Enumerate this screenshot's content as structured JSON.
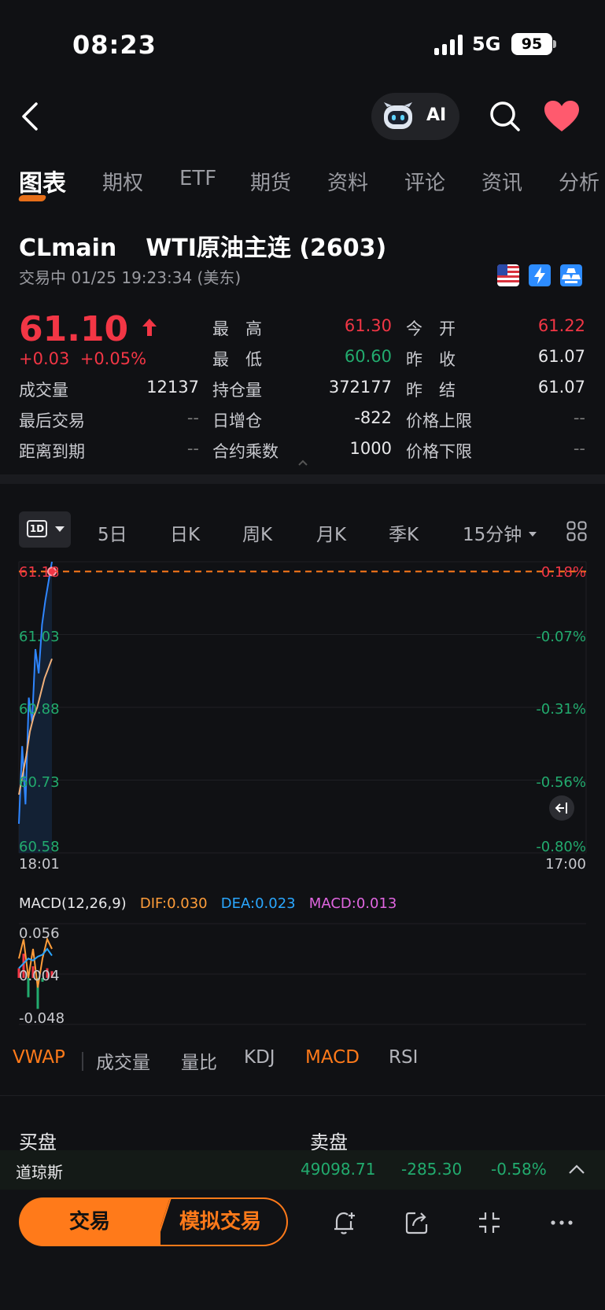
{
  "status_bar": {
    "time": "08:23",
    "network": "5G",
    "battery": "95"
  },
  "nav": {
    "ai_label": "AI"
  },
  "tabs": [
    "图表",
    "期权",
    "ETF",
    "期货",
    "资料",
    "评论",
    "资讯",
    "分析"
  ],
  "quote": {
    "symbol": "CLmain",
    "name": "WTI原油主连 (2603)",
    "status_line": "交易中 01/25 19:23:34 (美东)",
    "last_price": "61.10",
    "change": "+0.03",
    "change_pct": "+0.05%",
    "fields": {
      "high_label": "最　高",
      "high": "61.30",
      "open_label": "今　开",
      "open": "61.22",
      "low_label": "最　低",
      "low": "60.60",
      "prev_close_label": "昨　收",
      "prev_close": "61.07",
      "volume_label": "成交量",
      "volume": "12137",
      "oi_label": "持仓量",
      "oi": "372177",
      "prev_settle_label": "昨　结",
      "prev_settle": "61.07",
      "last_trade_label": "最后交易",
      "last_trade": "--",
      "oi_change_label": "日增仓",
      "oi_change": "-822",
      "limit_up_label": "价格上限",
      "limit_up": "--",
      "to_expiry_label": "距离到期",
      "to_expiry": "--",
      "multiplier_label": "合约乘数",
      "multiplier": "1000",
      "limit_down_label": "价格下限",
      "limit_down": "--"
    }
  },
  "periods": {
    "active": "1D",
    "items": [
      "5日",
      "日K",
      "周K",
      "月K",
      "季K",
      "15分钟"
    ]
  },
  "chart_data": [
    {
      "type": "line",
      "series": [
        {
          "values": [
            60.64,
            60.8,
            60.68,
            60.9,
            60.85,
            61.0,
            60.95,
            61.05,
            61.1,
            61.14,
            61.18
          ]
        },
        {
          "values": [
            60.7,
            60.74,
            60.78,
            60.83,
            60.86,
            60.88,
            60.91,
            60.94,
            60.96,
            60.98
          ]
        }
      ],
      "y_ticks_left": [
        "61.18",
        "61.03",
        "60.88",
        "60.73",
        "60.58"
      ],
      "y_ticks_right": [
        "0.18%",
        "-0.07%",
        "-0.31%",
        "-0.56%",
        "-0.80%"
      ],
      "x_ticks": [
        "18:01",
        "17:00"
      ],
      "ylim": [
        60.58,
        61.18
      ],
      "reference_price": 61.1,
      "grid": true
    },
    {
      "type": "line",
      "title": "MACD(12,26,9)",
      "indicators": {
        "dif": "DIF:0.030",
        "dea": "DEA:0.023",
        "macd": "MACD:0.013"
      },
      "y_ticks": [
        "0.056",
        "0.004",
        "-0.048"
      ],
      "ylim": [
        -0.048,
        0.056
      ],
      "series": [
        {
          "values": [
            0.02,
            0.04,
            0.0,
            0.03,
            -0.01,
            0.02,
            0.04,
            0.03
          ]
        },
        {
          "values": [
            0.01,
            0.015,
            0.02,
            0.018,
            0.022,
            0.024,
            0.03,
            0.023
          ]
        }
      ]
    }
  ],
  "indicator_tabs": [
    "VWAP",
    "成交量",
    "量比",
    "KDJ",
    "MACD",
    "RSI"
  ],
  "orderbook": {
    "buy_label": "买盘",
    "sell_label": "卖盘"
  },
  "ticker": {
    "name": "道琼斯",
    "value": "49098.71",
    "change": "-285.30",
    "change_pct": "-0.58%"
  },
  "bottom_bar": {
    "trade_label": "交易",
    "sim_label": "模拟交易"
  },
  "colors": {
    "up": "#f23645",
    "down": "#22ab6e",
    "accent": "#ff7a1a",
    "dif": "#ff9d3a",
    "dea": "#2aa7ff",
    "macd": "#e066e0"
  }
}
